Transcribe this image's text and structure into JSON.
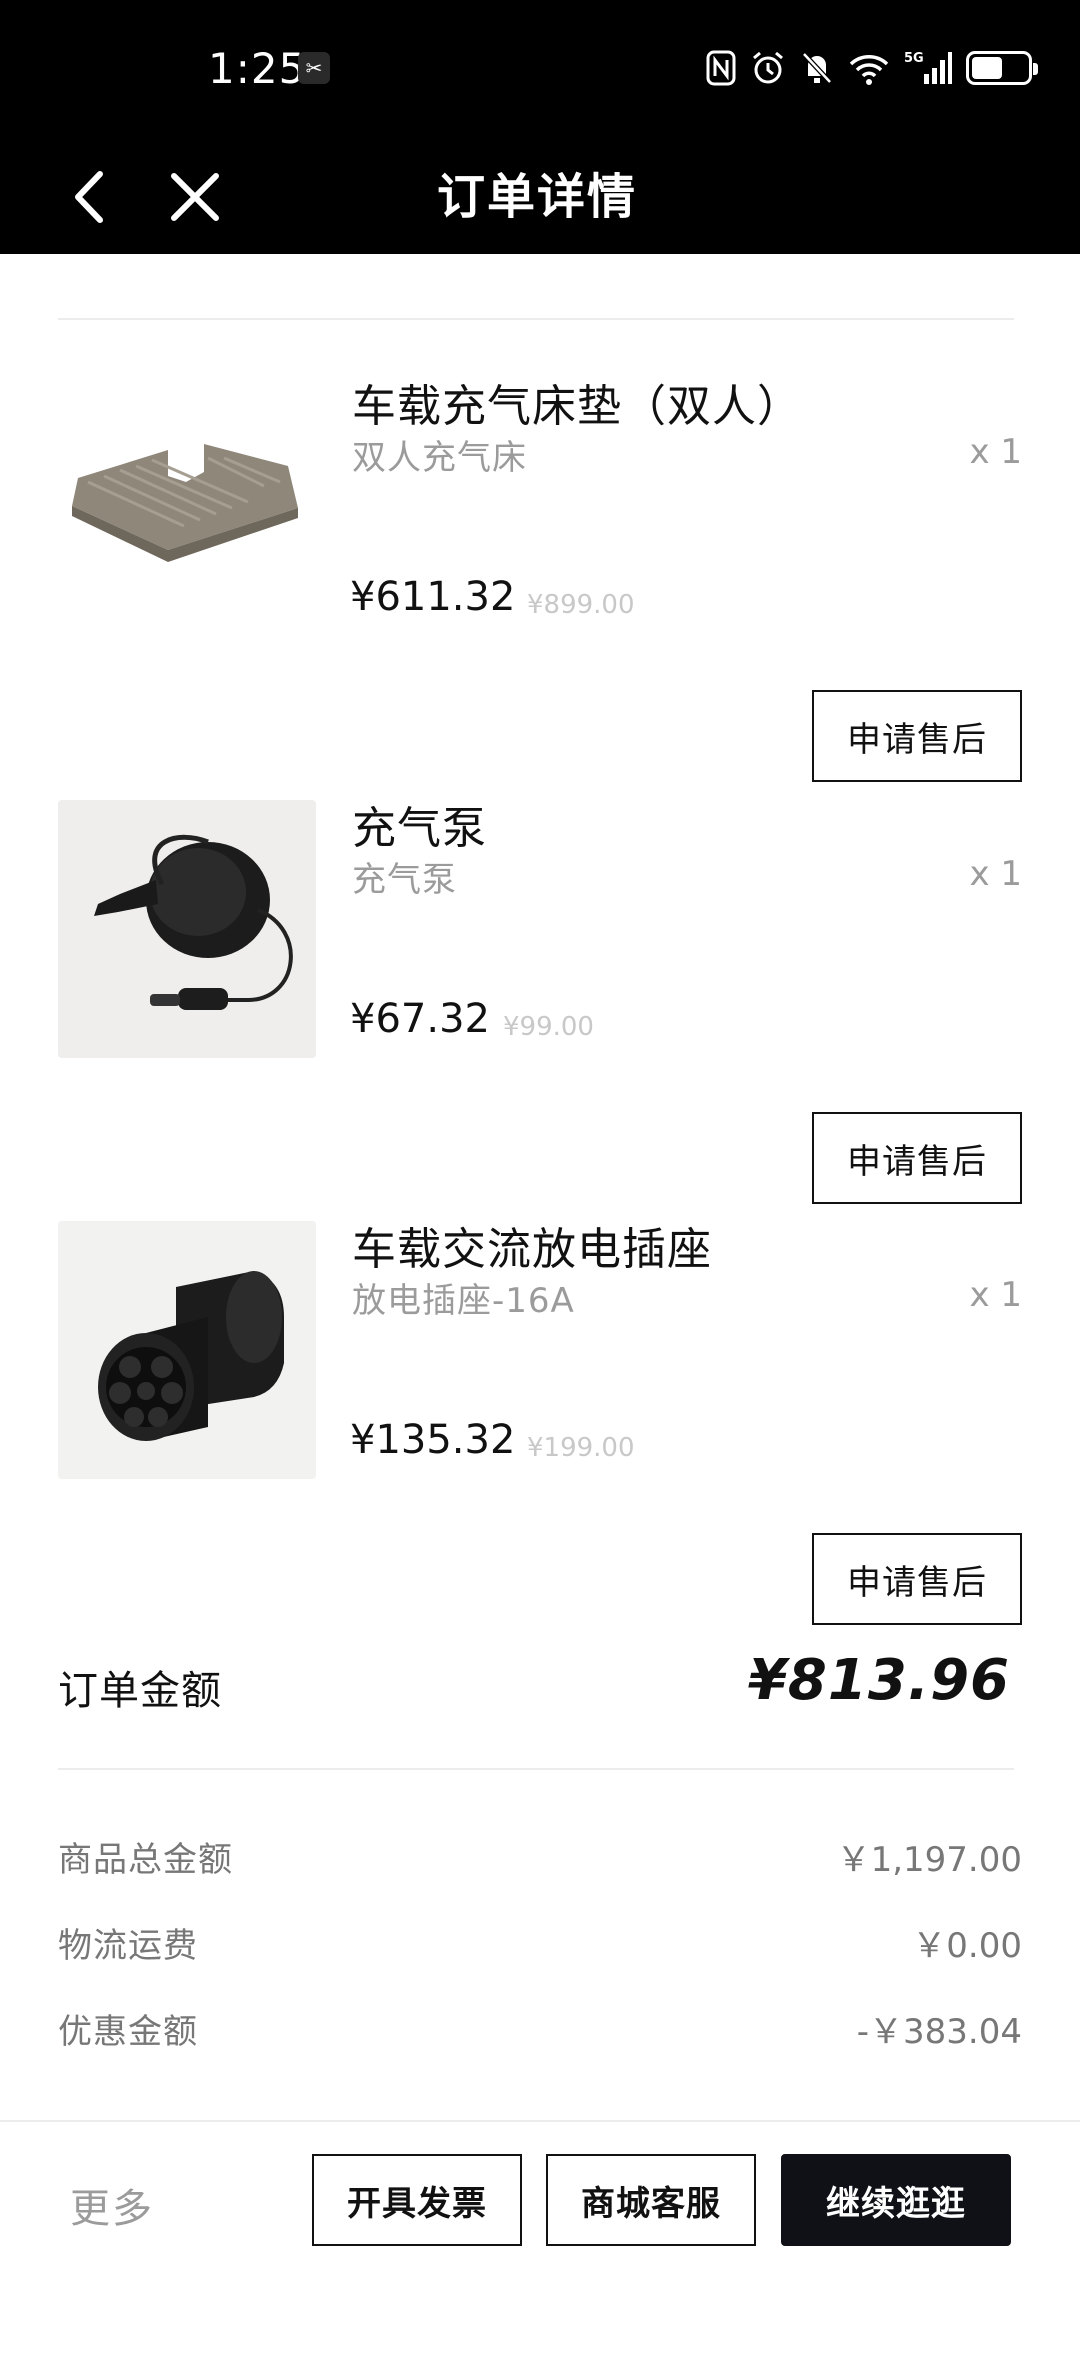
{
  "status_bar": {
    "time": "1:25",
    "badge": "✂",
    "signal_label": "5G",
    "sim_label": "6"
  },
  "nav": {
    "title": "订单详情"
  },
  "products": [
    {
      "name": "车载充气床垫（双人）",
      "spec": "双人充气床",
      "qty": "x 1",
      "price": "¥611.32",
      "original_price": "¥899.00",
      "action": "申请售后"
    },
    {
      "name": "充气泵",
      "spec": "充气泵",
      "qty": "x 1",
      "price": "¥67.32",
      "original_price": "¥99.00",
      "action": "申请售后"
    },
    {
      "name": "车载交流放电插座",
      "spec": "放电插座-16A",
      "qty": "x 1",
      "price": "¥135.32",
      "original_price": "¥199.00",
      "action": "申请售后"
    }
  ],
  "summary": {
    "total_label": "订单金额",
    "total_value": "¥813.96",
    "rows": [
      {
        "label": "商品总金额",
        "value": "￥1,197.00"
      },
      {
        "label": "物流运费",
        "value": "￥0.00"
      },
      {
        "label": "优惠金额",
        "value": "-￥383.04"
      }
    ]
  },
  "bottom_bar": {
    "more": "更多",
    "invoice": "开具发票",
    "service": "商城客服",
    "continue": "继续逛逛"
  }
}
